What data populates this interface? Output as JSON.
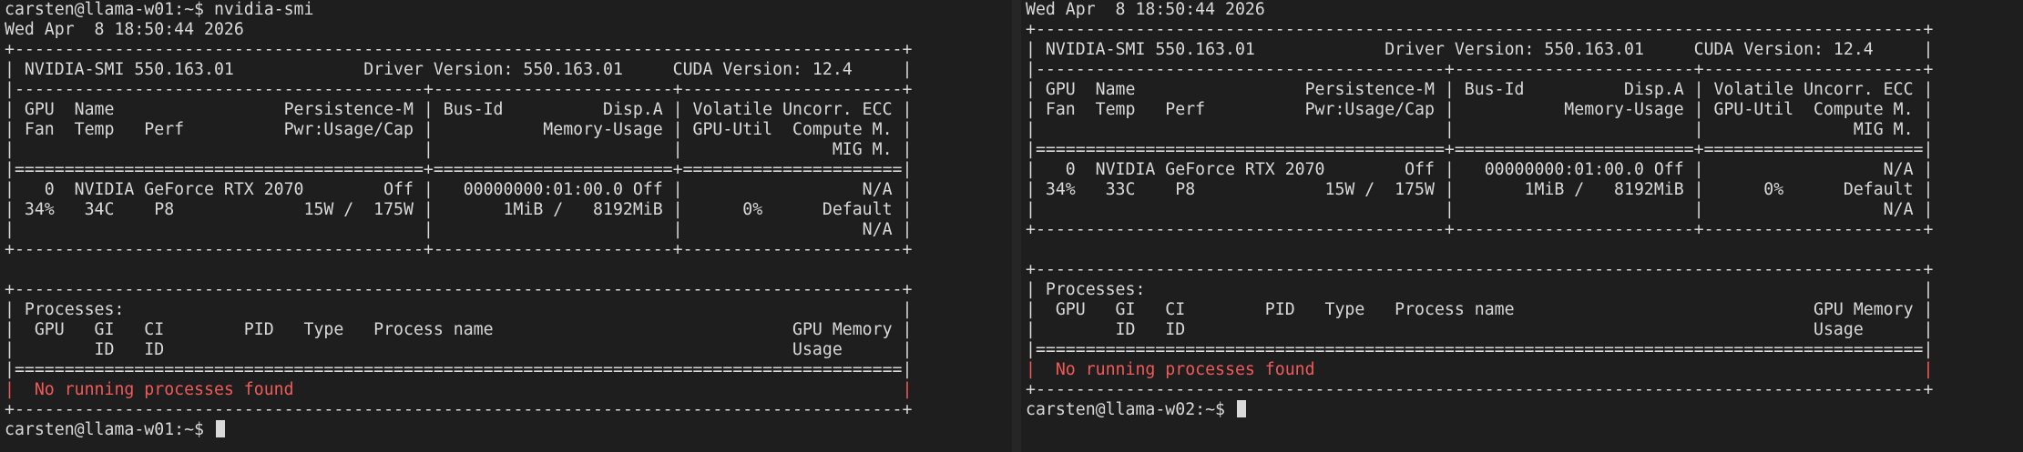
{
  "left": {
    "lines": [
      "carsten@llama-w01:~$ nvidia-smi",
      "Wed Apr  8 18:50:44 2026",
      "+-----------------------------------------------------------------------------------------+",
      "| NVIDIA-SMI 550.163.01             Driver Version: 550.163.01     CUDA Version: 12.4     |",
      "|-----------------------------------------+------------------------+----------------------+",
      "| GPU  Name                 Persistence-M | Bus-Id          Disp.A | Volatile Uncorr. ECC |",
      "| Fan  Temp   Perf          Pwr:Usage/Cap |           Memory-Usage | GPU-Util  Compute M. |",
      "|                                         |                        |               MIG M. |",
      "|=========================================+========================+======================|",
      "|   0  NVIDIA GeForce RTX 2070        Off |   00000000:01:00.0 Off |                  N/A |",
      "| 34%   34C    P8             15W /  175W |       1MiB /   8192MiB |      0%      Default |",
      "|                                         |                        |                  N/A |",
      "+-----------------------------------------+------------------------+----------------------+",
      "",
      "+-----------------------------------------------------------------------------------------+",
      "| Processes:                                                                              |",
      "|  GPU   GI   CI        PID   Type   Process name                              GPU Memory |",
      "|        ID   ID                                                               Usage      |",
      "|=========================================================================================|",
      "|  No running processes found                                                             |",
      "+-----------------------------------------------------------------------------------------+",
      "carsten@llama-w01:~$ "
    ],
    "error_line_index": 19,
    "cursor_line_index": 21
  },
  "right": {
    "lines": [
      "Wed Apr  8 18:50:44 2026",
      "+-----------------------------------------------------------------------------------------+",
      "| NVIDIA-SMI 550.163.01             Driver Version: 550.163.01     CUDA Version: 12.4     |",
      "|-----------------------------------------+------------------------+----------------------+",
      "| GPU  Name                 Persistence-M | Bus-Id          Disp.A | Volatile Uncorr. ECC |",
      "| Fan  Temp   Perf          Pwr:Usage/Cap |           Memory-Usage | GPU-Util  Compute M. |",
      "|                                         |                        |               MIG M. |",
      "|=========================================+========================+======================|",
      "|   0  NVIDIA GeForce RTX 2070        Off |   00000000:01:00.0 Off |                  N/A |",
      "| 34%   33C    P8             15W /  175W |       1MiB /   8192MiB |      0%      Default |",
      "|                                         |                        |                  N/A |",
      "+-----------------------------------------+------------------------+----------------------+",
      "",
      "+-----------------------------------------------------------------------------------------+",
      "| Processes:                                                                              |",
      "|  GPU   GI   CI        PID   Type   Process name                              GPU Memory |",
      "|        ID   ID                                                               Usage      |",
      "|=========================================================================================|",
      "|  No running processes found                                                             |",
      "+-----------------------------------------------------------------------------------------+",
      "carsten@llama-w02:~$ "
    ],
    "error_line_index": 18,
    "cursor_line_index": 20
  },
  "colors": {
    "background": "#1e1e1e",
    "foreground": "#d9d9d9",
    "error": "#f05a5a"
  }
}
